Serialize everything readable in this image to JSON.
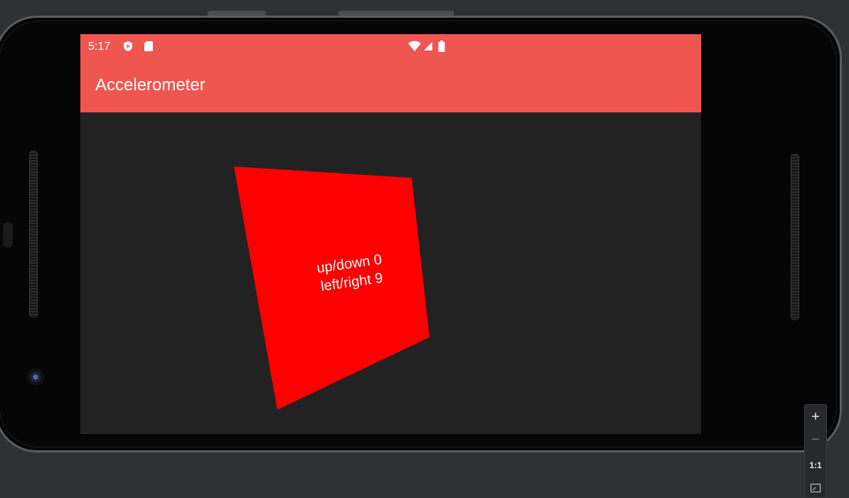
{
  "status_bar": {
    "time": "5:17",
    "icons_left": [
      "play-protect-icon",
      "sd-card-icon"
    ],
    "icons_right": [
      "wifi-icon",
      "cell-signal-icon",
      "battery-icon"
    ]
  },
  "app_bar": {
    "title": "Accelerometer"
  },
  "readout": {
    "up_down": "up/down 0",
    "left_right": "left/right 9"
  },
  "colors": {
    "app_bar": "#ef5650",
    "background": "#222222",
    "square": "#ff0000",
    "text": "#ffffff"
  },
  "zoom_controls": {
    "zoom_in": "+",
    "zoom_out": "−",
    "actual_size": "1:1",
    "fit_icon": "fit-screen-icon"
  }
}
